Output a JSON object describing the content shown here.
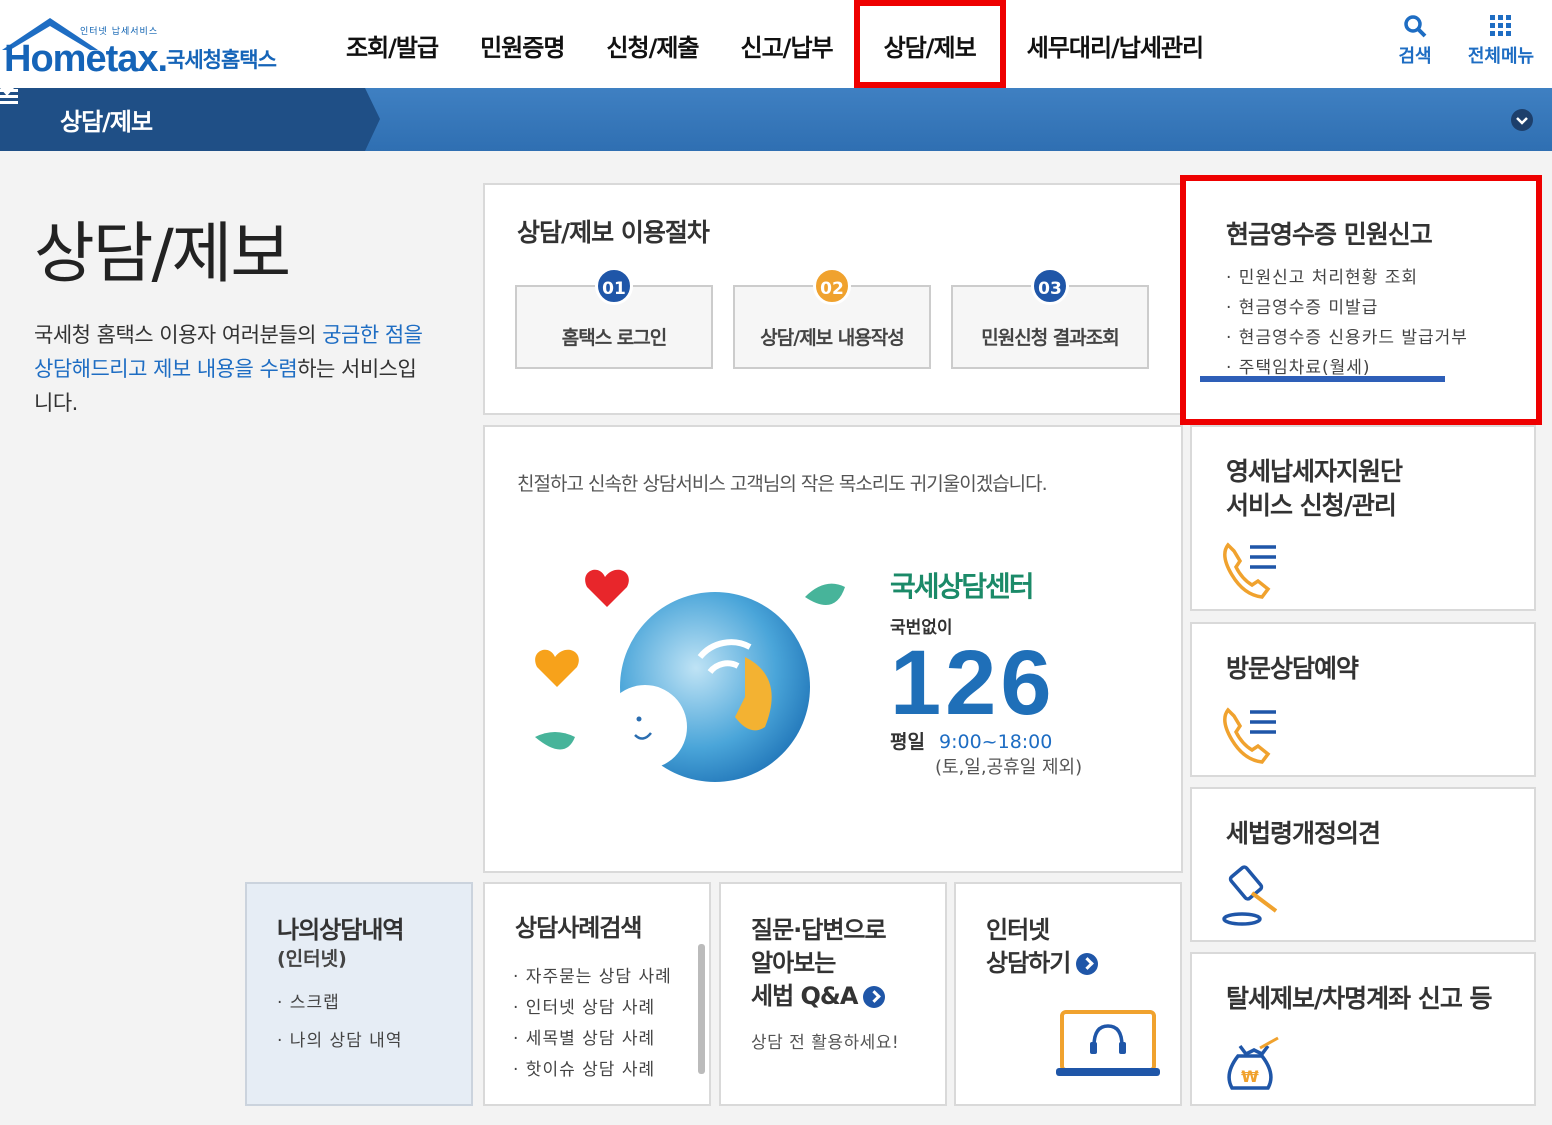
{
  "header": {
    "logo_tagline": "인터넷 납세서비스",
    "logo_text": "Hometax.",
    "logo_kr": "국세청홈택스",
    "nav": [
      {
        "label": "조회/발급"
      },
      {
        "label": "민원증명"
      },
      {
        "label": "신청/제출"
      },
      {
        "label": "신고/납부"
      },
      {
        "label": "상담/제보"
      },
      {
        "label": "세무대리/납세관리"
      }
    ],
    "search_label": "검색",
    "menu_label": "전체메뉴",
    "accent": "#1e6dc3",
    "highlight": "#ee0000"
  },
  "subbar": {
    "title": "상담/제보"
  },
  "intro": {
    "title": "상담/제보",
    "text_a": "국세청 홈택스 이용자 여러분들의 ",
    "text_b": "궁금한 점을 상담해드리고 제보 내용을 수렴",
    "text_c": "하는 서비스입니다."
  },
  "steps": {
    "title": "상담/제보 이용절차",
    "items": [
      {
        "num": "01",
        "label": "홈택스 로그인",
        "color": "#1f56a8"
      },
      {
        "num": "02",
        "label": "상담/제보 내용작성",
        "color": "#f0a22e"
      },
      {
        "num": "03",
        "label": "민원신청 결과조회",
        "color": "#1f56a8"
      }
    ]
  },
  "cash_receipt": {
    "title": "현금영수증 민원신고",
    "items": [
      "· 민원신고 처리현황 조회",
      "· 현금영수증 미발급",
      "· 현금영수증 신용카드 발급거부",
      "· 주택임차료(월세)"
    ]
  },
  "center": {
    "desc": "친절하고 신속한 상담서비스 고객님의 작은 목소리도 귀기울이겠습니다.",
    "brand": "국세상담센터",
    "sub": "국번없이",
    "number": "126",
    "hours_label": "평일",
    "hours": "9:00~18:00",
    "note": "(토,일,공휴일 제외)"
  },
  "side": {
    "small_taxpayer": "영세납세자지원단\n서비스 신청/관리",
    "small_taxpayer_1": "영세납세자지원단",
    "small_taxpayer_2": "서비스 신청/관리",
    "visit": "방문상담예약",
    "law": "세법령개정의견",
    "report": "탈세제보/차명계좌 신고 등"
  },
  "bottom": {
    "my": {
      "title": "나의상담내역",
      "sub": "(인터넷)",
      "items": [
        "· 스크랩",
        "· 나의 상담 내역"
      ]
    },
    "cases": {
      "title": "상담사례검색",
      "items": [
        "· 자주묻는 상담 사례",
        "· 인터넷 상담 사례",
        "· 세목별 상담 사례",
        "· 핫이슈 상담 사례"
      ]
    },
    "qa": {
      "title_1": "질문·답변으로",
      "title_2": "알아보는",
      "title_3": "세법 Q&A",
      "note": "상담 전 활용하세요!"
    },
    "internet": {
      "title_1": "인터넷",
      "title_2": "상담하기"
    }
  }
}
